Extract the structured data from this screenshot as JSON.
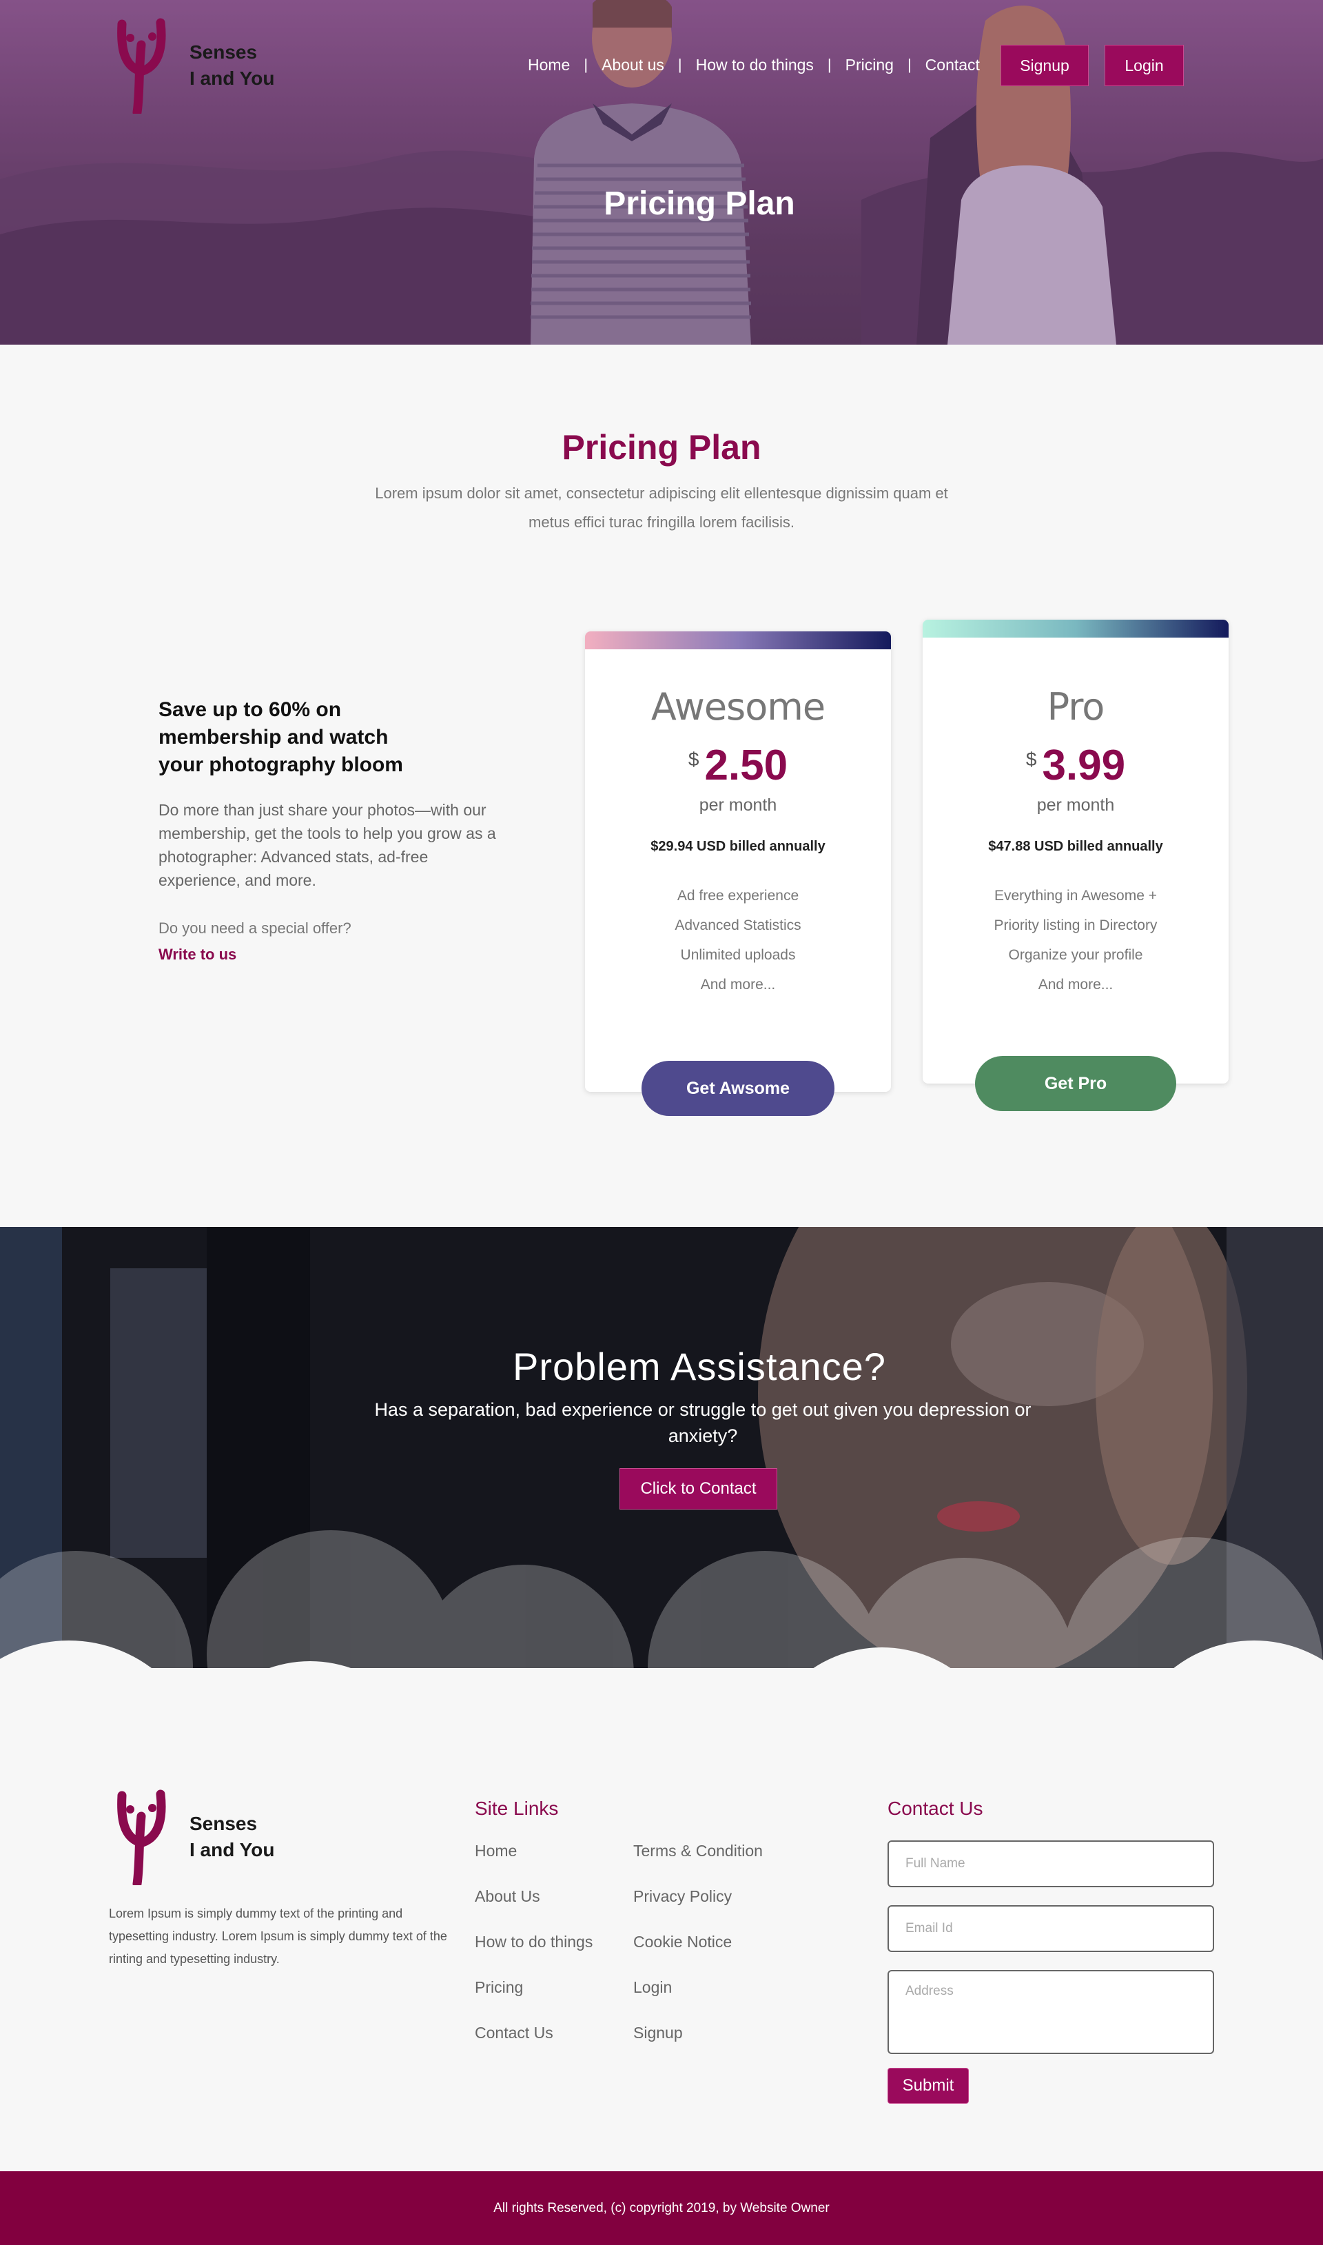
{
  "brand": {
    "line1": "Senses",
    "line2": "I and You",
    "color": "#8a0a4e"
  },
  "nav": {
    "items": [
      "Home",
      "About us",
      "How to do things",
      "Pricing",
      "Contact"
    ],
    "separator": "|",
    "signup": "Signup",
    "login": "Login"
  },
  "hero": {
    "title": "Pricing Plan"
  },
  "pricing": {
    "title": "Pricing Plan",
    "subtitle": "Lorem ipsum dolor sit amet, consectetur adipiscing elit ellentesque dignissim quam et metus effici turac fringilla lorem facilisis.",
    "offer": {
      "heading": "Save up to 60% on membership and watch your photography bloom",
      "description": "Do more than just share your photos—with our membership, get the tools to help you grow as a photographer: Advanced stats, ad-free experience, and more.",
      "special_question": "Do you need a special offer?",
      "write_link": "Write to us"
    },
    "plans": [
      {
        "name": "Awesome",
        "currency": "$",
        "price": "2.50",
        "period": "per month",
        "billed": "$29.94 USD billed annually",
        "features": [
          "Ad free experience",
          "Advanced Statistics",
          "Unlimited uploads",
          "And more..."
        ],
        "button": "Get Awsome",
        "button_color": "#4f4a8e",
        "bar_gradient": [
          "#f2afc0",
          "#8a7ab8",
          "#141a5c"
        ]
      },
      {
        "name": "Pro",
        "currency": "$",
        "price": "3.99",
        "period": "per month",
        "billed": "$47.88 USD billed annually",
        "features": [
          "Everything in Awesome +",
          "Priority listing in Directory",
          "Organize your profile",
          "And more..."
        ],
        "button": "Get Pro",
        "button_color": "#4f8b60",
        "bar_gradient": [
          "#b8f2e0",
          "#7ab8c0",
          "#141a5c"
        ]
      }
    ]
  },
  "problem": {
    "title": "Problem Assistance?",
    "text": "Has a separation, bad experience or struggle to get out given you depression or anxiety?",
    "button": "Click to Contact"
  },
  "footer": {
    "about": "Lorem Ipsum is simply dummy text of the  printing and typesetting industry. Lorem  Ipsum is simply dummy text of the   rinting and typesetting industry.",
    "site_links_title": "Site Links",
    "links_col1": [
      "Home",
      "About Us",
      "How to do things",
      "Pricing",
      "Contact Us"
    ],
    "links_col2": [
      "Terms & Condition",
      "Privacy Policy",
      "Cookie Notice",
      "Login",
      "Signup"
    ],
    "contact_title": "Contact Us",
    "form": {
      "full_name_placeholder": "Full Name",
      "email_placeholder": "Email Id",
      "address_placeholder": "Address",
      "submit": "Submit"
    },
    "copyright": "All rights Reserved, (c) copyright 2019, by Website Owner"
  }
}
